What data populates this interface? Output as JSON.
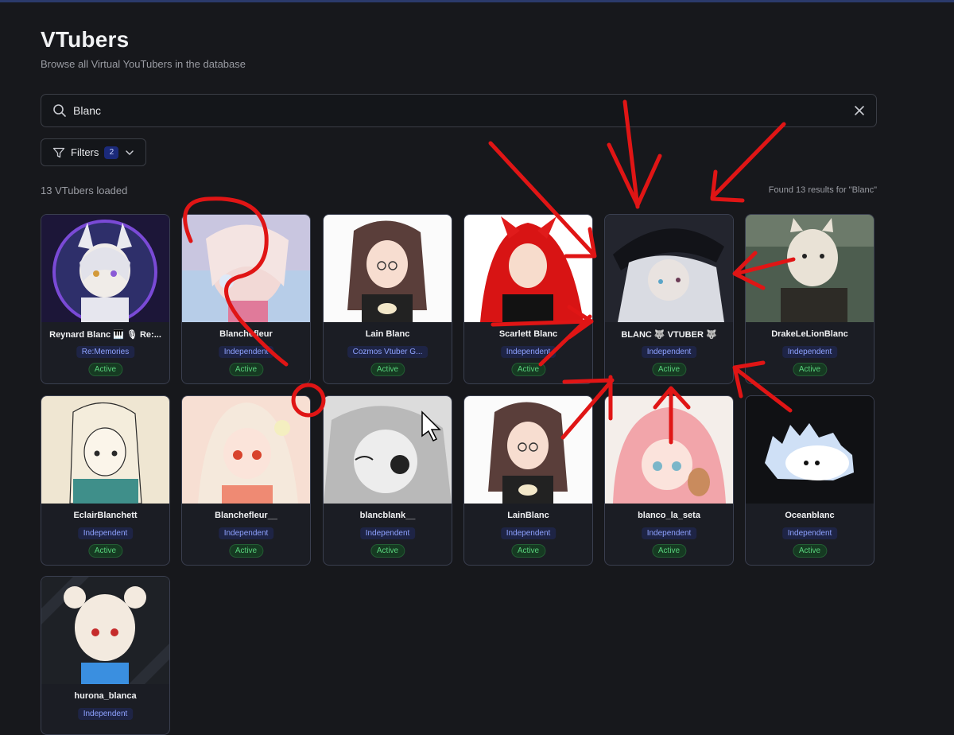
{
  "page": {
    "title": "VTubers",
    "subtitle": "Browse all Virtual YouTubers in the database",
    "loaded_text": "13 VTubers loaded",
    "results_text": "Found 13 results for \"Blanc\""
  },
  "search": {
    "value": "Blanc",
    "search_icon": "search-icon",
    "clear_icon": "close-icon"
  },
  "filters": {
    "label": "Filters",
    "count": "2",
    "icon": "filter-icon",
    "chevron": "chevron-down-icon"
  },
  "colors": {
    "background": "#17181c",
    "card": "#1b1d24",
    "agency_text": "#8ea2ff",
    "active_text": "#59d27c",
    "annotation": "#e01515"
  },
  "vtubers": [
    {
      "name": "Reynard Blanc 🎹 🎙 Re:...",
      "agency": "Re:Memories",
      "status": "Active"
    },
    {
      "name": "Blanchefleur",
      "agency": "Independent",
      "status": "Active"
    },
    {
      "name": "Lain Blanc",
      "agency": "Cozmos Vtuber G...",
      "status": "Active"
    },
    {
      "name": "Scarlett Blanc",
      "agency": "Independent",
      "status": "Active"
    },
    {
      "name": "BLANC 🐺 VTUBER 🐺",
      "agency": "Independent",
      "status": "Active"
    },
    {
      "name": "DrakeLeLionBlanc",
      "agency": "Independent",
      "status": "Active"
    },
    {
      "name": "EclairBlanchett",
      "agency": "Independent",
      "status": "Active"
    },
    {
      "name": "Blanchefleur__",
      "agency": "Independent",
      "status": "Active"
    },
    {
      "name": "blancblank__",
      "agency": "Independent",
      "status": "Active"
    },
    {
      "name": "LainBlanc",
      "agency": "Independent",
      "status": "Active"
    },
    {
      "name": "blanco_la_seta",
      "agency": "Independent",
      "status": "Active"
    },
    {
      "name": "Oceanblanc",
      "agency": "Independent",
      "status": "Active"
    },
    {
      "name": "hurona_blanca",
      "agency": "Independent",
      "status": ""
    }
  ]
}
